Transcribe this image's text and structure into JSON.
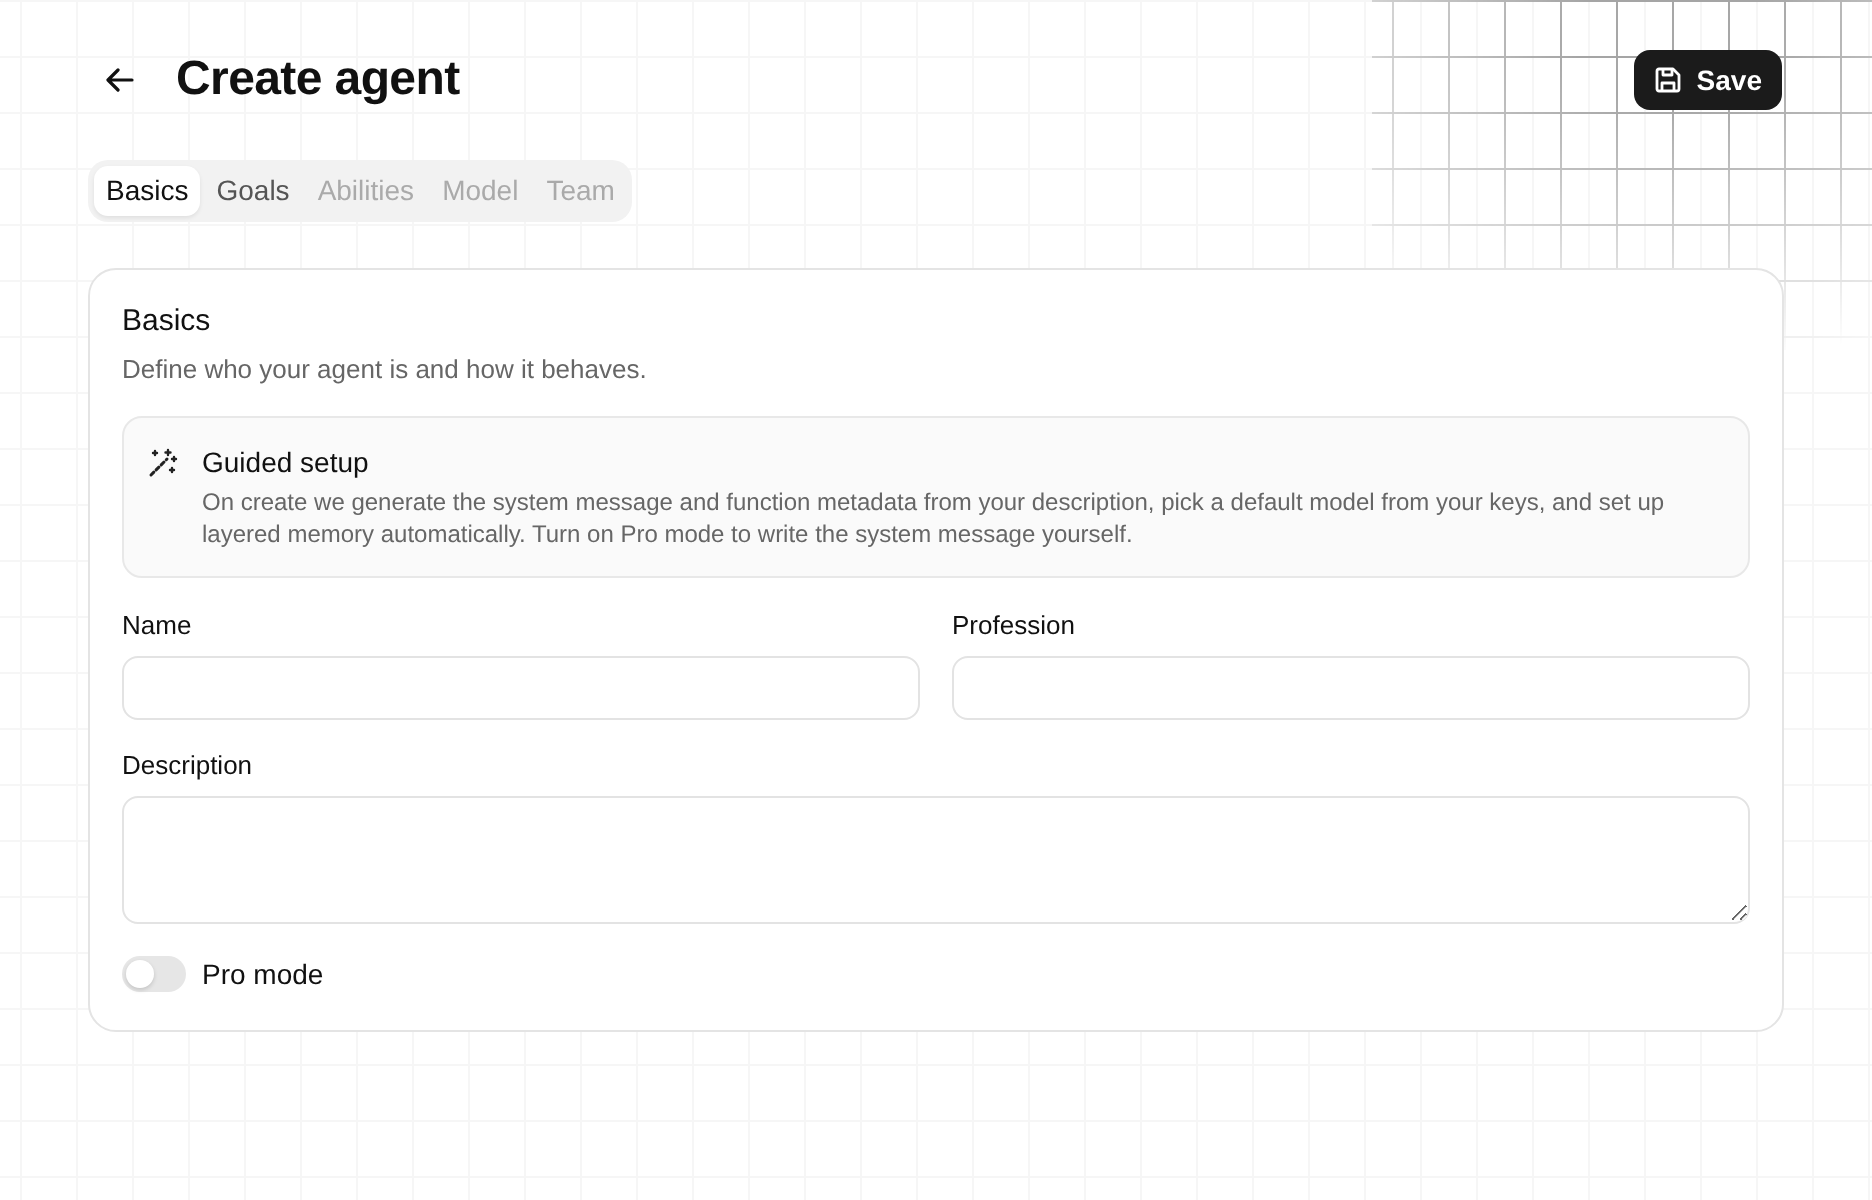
{
  "header": {
    "title": "Create agent",
    "save_button": {
      "label": "Save"
    }
  },
  "tabs": [
    {
      "label": "Basics",
      "selected": true,
      "disabled": false
    },
    {
      "label": "Goals",
      "selected": false,
      "disabled": false
    },
    {
      "label": "Abilities",
      "selected": false,
      "disabled": true
    },
    {
      "label": "Model",
      "selected": false,
      "disabled": true
    },
    {
      "label": "Team",
      "selected": false,
      "disabled": true
    }
  ],
  "section": {
    "title": "Basics",
    "subtitle": "Define who your agent is and how it behaves.",
    "callout": {
      "title": "Guided setup",
      "text": "On create we generate the system message and function metadata from your description, pick a default model from your keys, and set up layered memory automatically. Turn on Pro mode to write the system message yourself."
    },
    "fields": [
      {
        "kind": "input",
        "label": "Name"
      },
      {
        "kind": "input",
        "label": "Profession"
      },
      {
        "kind": "textarea",
        "label": "Description"
      }
    ],
    "toggle": {
      "label": "Pro mode",
      "on": false
    }
  }
}
